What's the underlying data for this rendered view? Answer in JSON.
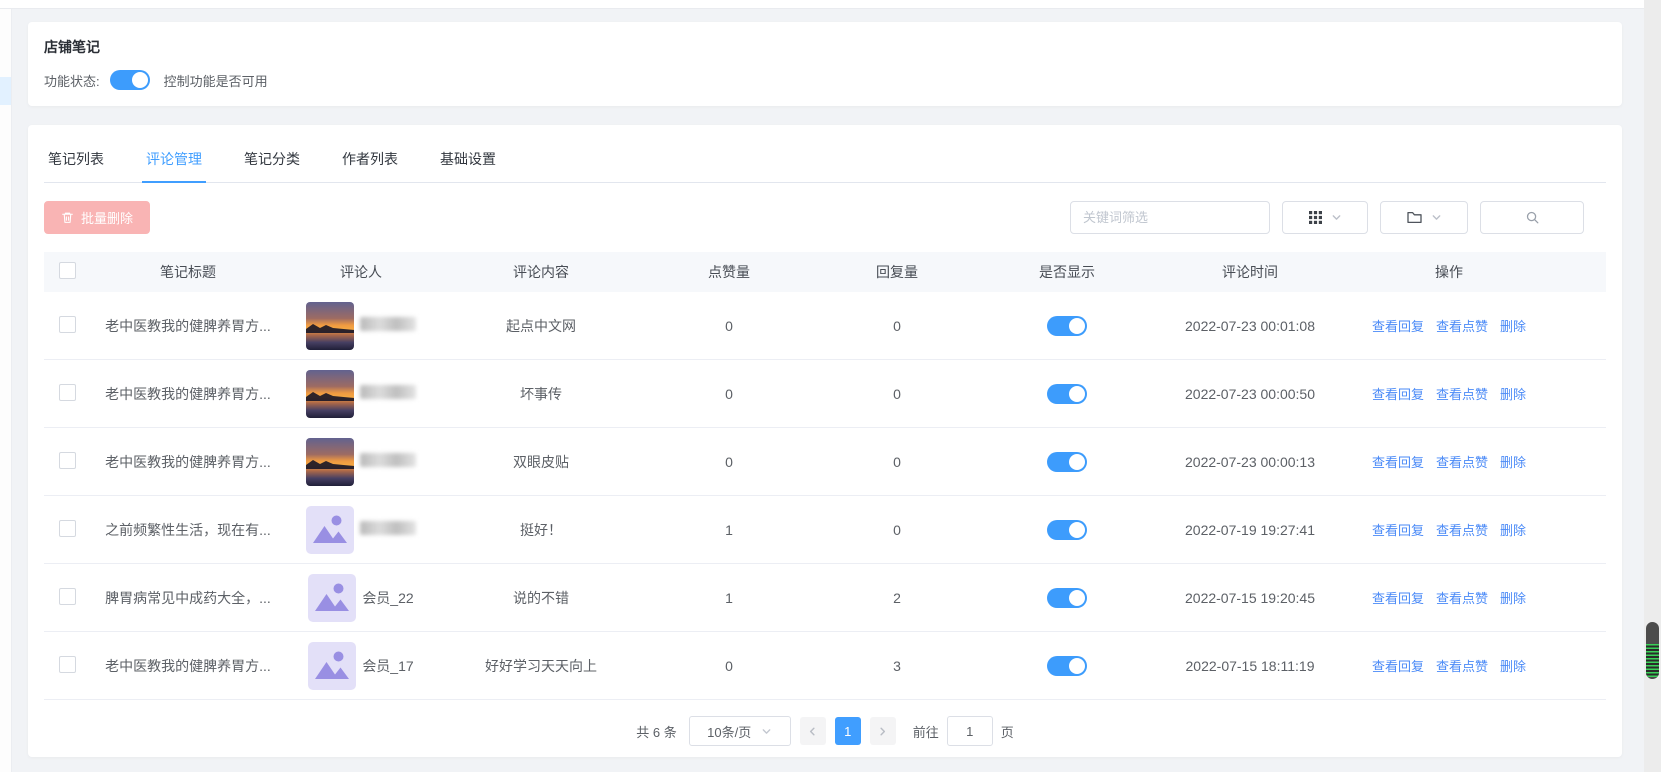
{
  "shop_note_card": {
    "title": "店铺笔记",
    "status_label": "功能状态:",
    "status_hint": "控制功能是否可用",
    "status_on": true
  },
  "tabs": [
    {
      "key": "note-list",
      "label": "笔记列表",
      "active": false
    },
    {
      "key": "comment-management",
      "label": "评论管理",
      "active": true
    },
    {
      "key": "note-category",
      "label": "笔记分类",
      "active": false
    },
    {
      "key": "author-list",
      "label": "作者列表",
      "active": false
    },
    {
      "key": "basic-settings",
      "label": "基础设置",
      "active": false
    }
  ],
  "toolbar": {
    "batch_delete_label": "批量删除",
    "keyword_placeholder": "关键词筛选"
  },
  "table": {
    "columns": [
      "笔记标题",
      "评论人",
      "评论内容",
      "点赞量",
      "回复量",
      "是否显示",
      "评论时间",
      "操作"
    ],
    "actions": [
      "查看回复",
      "查看点赞",
      "删除"
    ],
    "rows": [
      {
        "title": "老中医教我的健脾养胃方...",
        "avatar": "sunset-photo",
        "commenter": "",
        "commenter_blurred": true,
        "comment": "起点中文网",
        "likes": "0",
        "replies": "0",
        "visible": true,
        "time": "2022-07-23 00:01:08"
      },
      {
        "title": "老中医教我的健脾养胃方...",
        "avatar": "sunset-photo",
        "commenter": "",
        "commenter_blurred": true,
        "comment": "坏事传",
        "likes": "0",
        "replies": "0",
        "visible": true,
        "time": "2022-07-23 00:00:50"
      },
      {
        "title": "老中医教我的健脾养胃方...",
        "avatar": "sunset-photo",
        "commenter": "",
        "commenter_blurred": true,
        "comment": "双眼皮贴",
        "likes": "0",
        "replies": "0",
        "visible": true,
        "time": "2022-07-23 00:00:13"
      },
      {
        "title": "之前频繁性生活，现在有...",
        "avatar": "image-placeholder",
        "commenter": "",
        "commenter_blurred": true,
        "comment": "挺好！",
        "likes": "1",
        "replies": "0",
        "visible": true,
        "time": "2022-07-19 19:27:41"
      },
      {
        "title": "脾胃病常见中成药大全，...",
        "avatar": "image-placeholder",
        "commenter": "会员_22",
        "commenter_blurred": false,
        "comment": "说的不错",
        "likes": "1",
        "replies": "2",
        "visible": true,
        "time": "2022-07-15 19:20:45"
      },
      {
        "title": "老中医教我的健脾养胃方...",
        "avatar": "image-placeholder",
        "commenter": "会员_17",
        "commenter_blurred": false,
        "comment": "好好学习天天向上",
        "likes": "0",
        "replies": "3",
        "visible": true,
        "time": "2022-07-15 18:11:19"
      }
    ]
  },
  "pagination": {
    "total_text": "共 6 条",
    "page_size_value": "10条/页",
    "current_page": "1",
    "goto_label": "前往",
    "goto_value": "1",
    "goto_suffix": "页"
  },
  "colors": {
    "accent": "#409eff",
    "link": "#4a8af7",
    "toggle_on": "#3d9cfc",
    "danger_disabled_bg": "#f9b4b4",
    "scrollbar_green": "#3ad158"
  }
}
